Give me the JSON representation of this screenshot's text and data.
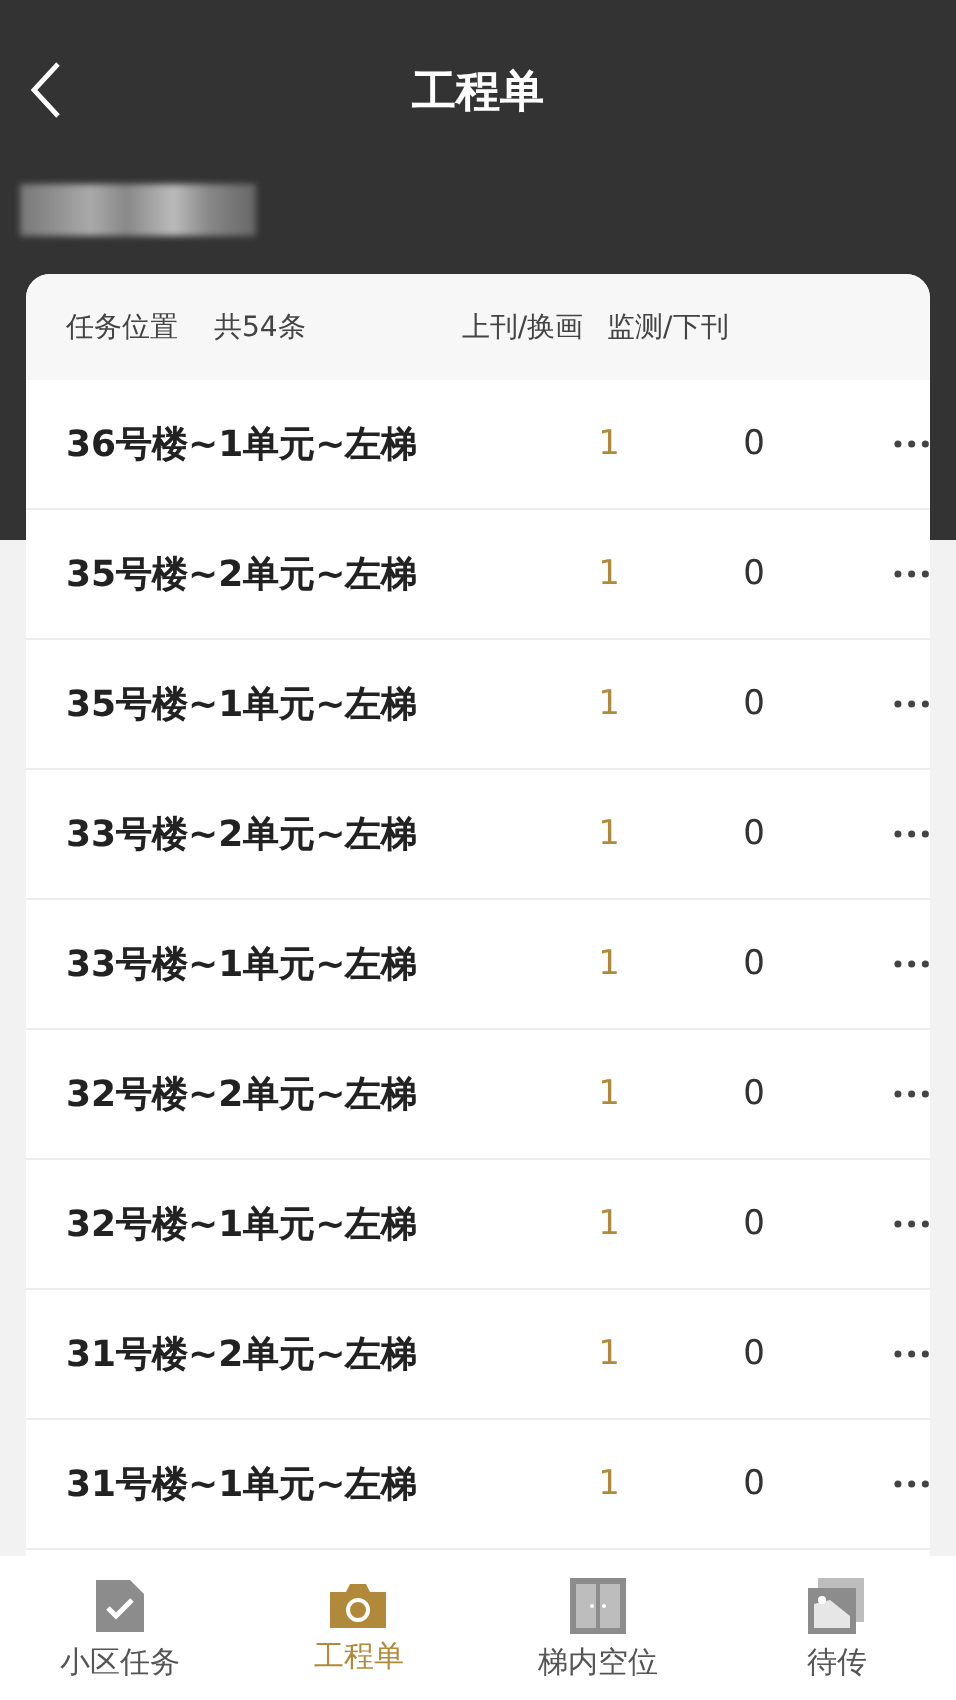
{
  "header": {
    "title": "工程单"
  },
  "table": {
    "columns": [
      "任务位置",
      "共54条",
      "上刊/换画",
      "监测/下刊"
    ],
    "rows": [
      {
        "location": "36号楼~1单元~左梯",
        "publish": "1",
        "monitor": "0"
      },
      {
        "location": "35号楼~2单元~左梯",
        "publish": "1",
        "monitor": "0"
      },
      {
        "location": "35号楼~1单元~左梯",
        "publish": "1",
        "monitor": "0"
      },
      {
        "location": "33号楼~2单元~左梯",
        "publish": "1",
        "monitor": "0"
      },
      {
        "location": "33号楼~1单元~左梯",
        "publish": "1",
        "monitor": "0"
      },
      {
        "location": "32号楼~2单元~左梯",
        "publish": "1",
        "monitor": "0"
      },
      {
        "location": "32号楼~1单元~左梯",
        "publish": "1",
        "monitor": "0"
      },
      {
        "location": "31号楼~2单元~左梯",
        "publish": "1",
        "monitor": "0"
      },
      {
        "location": "31号楼~1单元~左梯",
        "publish": "1",
        "monitor": "0"
      }
    ]
  },
  "tab_bar": [
    {
      "label": "小区任务",
      "kind": "task",
      "selected": false
    },
    {
      "label": "工程单",
      "kind": "camera",
      "selected": true
    },
    {
      "label": "梯内空位",
      "kind": "doors",
      "selected": false
    },
    {
      "label": "待传",
      "kind": "photos",
      "selected": false
    }
  ]
}
